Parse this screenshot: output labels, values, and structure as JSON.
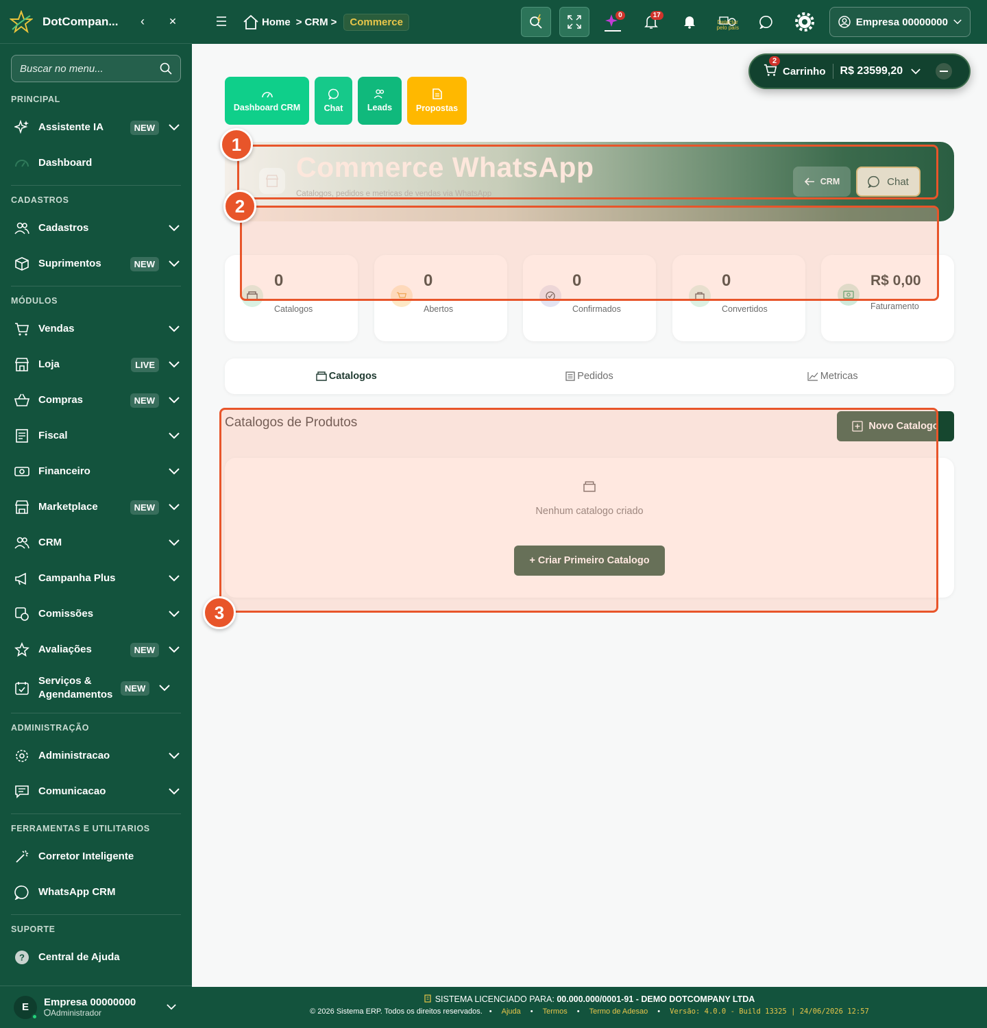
{
  "sidebar": {
    "brand": "DotCompan...",
    "collapse_glyph": "‹",
    "close_glyph": "✕",
    "search_placeholder": "Buscar no menu...",
    "sections": {
      "principal": "PRINCIPAL",
      "cadastros": "CADASTROS",
      "modulos": "MÓDULOS",
      "administracao": "ADMINISTRAÇÃO",
      "ferramentas": "FERRAMENTAS E UTILITARIOS",
      "suporte": "SUPORTE"
    },
    "items": {
      "assistente": {
        "label": "Assistente IA",
        "badge": "NEW"
      },
      "dashboard": {
        "label": "Dashboard"
      },
      "cadastros": {
        "label": "Cadastros"
      },
      "suprimentos": {
        "label": "Suprimentos",
        "badge": "NEW"
      },
      "vendas": {
        "label": "Vendas"
      },
      "loja": {
        "label": "Loja",
        "badge": "LIVE"
      },
      "compras": {
        "label": "Compras",
        "badge": "NEW"
      },
      "fiscal": {
        "label": "Fiscal"
      },
      "financeiro": {
        "label": "Financeiro"
      },
      "marketplace": {
        "label": "Marketplace",
        "badge": "NEW"
      },
      "crm": {
        "label": "CRM"
      },
      "campanha": {
        "label": "Campanha Plus"
      },
      "comissoes": {
        "label": "Comissões"
      },
      "avaliacoes": {
        "label": "Avaliações",
        "badge": "NEW"
      },
      "servicos": {
        "label": "Serviços & Agendamentos",
        "badge": "NEW"
      },
      "administracao": {
        "label": "Administracao"
      },
      "comunicacao": {
        "label": "Comunicacao"
      },
      "corretor": {
        "label": "Corretor Inteligente"
      },
      "whatsapp": {
        "label": "WhatsApp CRM"
      },
      "ajuda": {
        "label": "Central de Ajuda"
      }
    },
    "user": {
      "initial": "E",
      "name": "Empresa 00000000",
      "role": "Administrador"
    }
  },
  "topbar": {
    "breadcrumb": {
      "home": "Home",
      "crm": "CRM",
      "sep": ">",
      "current": "Commerce"
    },
    "ai_count": "0",
    "notif_count": "17",
    "detect_label": "Detectar pelo país",
    "user_label": "Empresa 00000000"
  },
  "cart": {
    "count": "2",
    "label": "Carrinho",
    "total": "R$ 23599,20"
  },
  "quick_buttons": [
    {
      "label": "Dashboard CRM"
    },
    {
      "label": "Chat"
    },
    {
      "label": "Leads"
    },
    {
      "label": "Propostas"
    }
  ],
  "hero": {
    "title": "Commerce WhatsApp",
    "subtitle": "Catalogos, pedidos e metricas de vendas via WhatsApp",
    "crm_button": "CRM",
    "chat_button": "Chat"
  },
  "stats": [
    {
      "value": "0",
      "label": "Catalogos"
    },
    {
      "value": "0",
      "label": "Abertos"
    },
    {
      "value": "0",
      "label": "Confirmados"
    },
    {
      "value": "0",
      "label": "Convertidos"
    },
    {
      "value": "R$ 0,00",
      "label": "Faturamento"
    }
  ],
  "tabs": [
    {
      "label": "Catalogos"
    },
    {
      "label": "Pedidos"
    },
    {
      "label": "Metricas"
    }
  ],
  "catalog": {
    "title": "Catalogos de Produtos",
    "new_button": "Novo Catalogo",
    "empty_text": "Nenhum catalogo criado",
    "create_button": "+ Criar Primeiro Catalogo"
  },
  "annotations": {
    "m1": "1",
    "m2": "2",
    "m3": "3"
  },
  "footer": {
    "license_prefix": "SISTEMA LICENCIADO PARA:",
    "license_value": "00.000.000/0001-91 - DEMO DOTCOMPANY LTDA",
    "copyright": "© 2026 Sistema ERP. Todos os direitos reservados.",
    "bullet": "•",
    "links": [
      "Ajuda",
      "Termos",
      "Termo de Adesao"
    ],
    "version": "Versão: 4.0.0 - Build 13325 | 24/06/2026 12:57"
  },
  "colors": {
    "brand": "#13533d",
    "accent": "#e8c64a",
    "annotation": "#e8552a",
    "green_btn": "#0fcf8a",
    "orange_btn": "#ffb800"
  }
}
